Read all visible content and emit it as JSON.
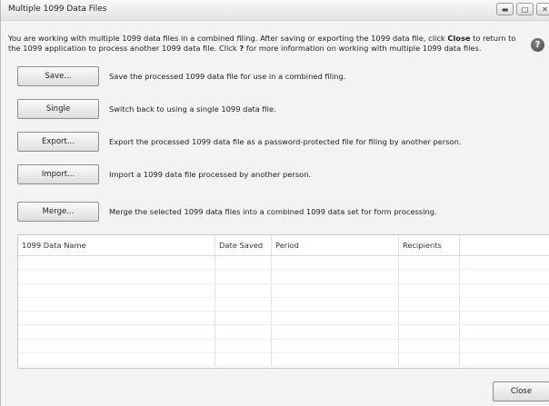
{
  "window": {
    "title": "Multiple 1099 Data Files"
  },
  "intro": {
    "part1": "You are working with multiple 1099 data files in a combined filing. After saving or exporting the 1099 data file, click ",
    "bold1": "Close",
    "part2": " to return to the 1099 application to process another 1099 data file. Click ",
    "bold2": "?",
    "part3": " for more information on working with multiple 1099 data files."
  },
  "help": {
    "glyph": "?"
  },
  "actions": [
    {
      "label": "Save...",
      "description": "Save the processed 1099 data file for use in a combined filing."
    },
    {
      "label": "Single",
      "description": "Switch back to using a single 1099 data file."
    },
    {
      "label": "Export...",
      "description": "Export the processed 1099 data file as a password-protected file for filing by another person."
    },
    {
      "label": "Import...",
      "description": "Import a 1099 data file processed by another person."
    },
    {
      "label": "Merge...",
      "description": "Merge the selected 1099 data files into a combined 1099 data set for form processing."
    }
  ],
  "grid": {
    "columns": [
      "1099 Data Name",
      "Date Saved",
      "Period",
      "Recipients",
      ""
    ]
  },
  "footer": {
    "close_label": "Close"
  }
}
